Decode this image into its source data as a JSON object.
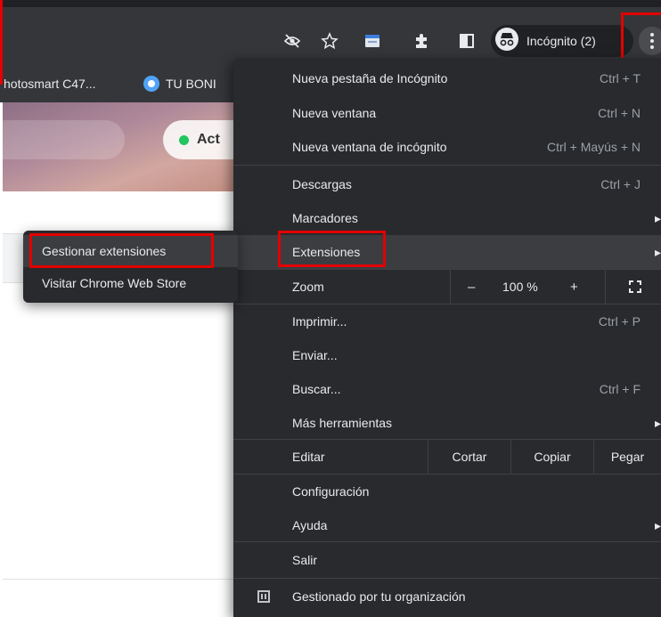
{
  "toolbar": {
    "incognito_label": "Incógnito (2)",
    "icons": [
      "eye-off-icon",
      "star-icon",
      "extension-app-icon",
      "puzzle-icon",
      "side-panel-icon",
      "incognito-icon",
      "more-vert-icon"
    ]
  },
  "bookmarks": {
    "item_1": "hotosmart C47...",
    "item_2": "TU BONI"
  },
  "page": {
    "pill_text": "Act"
  },
  "submenu": {
    "items": [
      "Gestionar extensiones",
      "Visitar Chrome Web Store"
    ]
  },
  "menu": {
    "new_incognito_tab": {
      "label": "Nueva pestaña de Incógnito",
      "shortcut": "Ctrl + T"
    },
    "new_window": {
      "label": "Nueva ventana",
      "shortcut": "Ctrl + N"
    },
    "new_incognito_window": {
      "label": "Nueva ventana de incógnito",
      "shortcut": "Ctrl + Mayús + N"
    },
    "downloads": {
      "label": "Descargas",
      "shortcut": "Ctrl + J"
    },
    "bookmarks": {
      "label": "Marcadores"
    },
    "extensions": {
      "label": "Extensiones"
    },
    "zoom": {
      "label": "Zoom",
      "minus": "–",
      "value": "100 %",
      "plus": "+"
    },
    "print": {
      "label": "Imprimir...",
      "shortcut": "Ctrl + P"
    },
    "send": {
      "label": "Enviar..."
    },
    "find": {
      "label": "Buscar...",
      "shortcut": "Ctrl + F"
    },
    "more_tools": {
      "label": "Más herramientas"
    },
    "edit": {
      "label": "Editar",
      "cut": "Cortar",
      "copy": "Copiar",
      "paste": "Pegar"
    },
    "settings": {
      "label": "Configuración"
    },
    "help": {
      "label": "Ayuda"
    },
    "exit": {
      "label": "Salir"
    },
    "managed": {
      "label": "Gestionado por tu organización"
    }
  },
  "colors": {
    "highlight_box": "#e30000",
    "menu_bg": "#292a2d",
    "menu_hover": "#3c3d41",
    "toolbar_bg": "#35363a"
  }
}
